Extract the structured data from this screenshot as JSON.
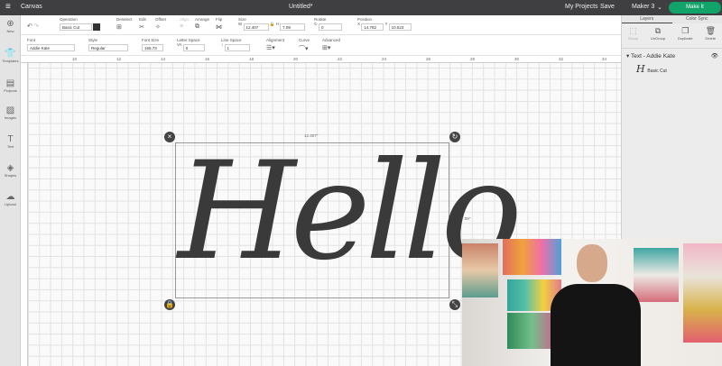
{
  "topbar": {
    "title": "Canvas",
    "doc": "Untitled*",
    "my_projects": "My Projects",
    "save": "Save",
    "machine": "Maker 3",
    "make_it": "Make It"
  },
  "sidebar": [
    "New",
    "Templates",
    "Projects",
    "Images",
    "Text",
    "Shapes",
    "Upload"
  ],
  "toolbar1": {
    "operation_label": "Operation",
    "operation": "Basic Cut",
    "deselect": "Deselect",
    "edit": "Edit",
    "offset": "Offset",
    "align": "Align",
    "arrange": "Arrange",
    "flip": "Flip",
    "size": "Size",
    "w_label": "W",
    "w": "12.407",
    "h_label": "H",
    "h": "7.09",
    "rotate": "Rotate",
    "rotate_val": "0",
    "position": "Position",
    "x_label": "X",
    "x": "14.782",
    "y_label": "Y",
    "y": "10.523"
  },
  "toolbar2": {
    "font_label": "Font",
    "font": "Addie Kate",
    "style_label": "Style",
    "style": "Regular",
    "font_size_label": "Font Size",
    "font_size": "165.73",
    "letter_space_label": "Letter Space",
    "letter_space": "0",
    "line_space_label": "Line Space",
    "line_space": "1",
    "alignment": "Alignment",
    "curve": "Curve",
    "advanced": "Advanced"
  },
  "ruler": [
    "10",
    "12",
    "14",
    "16",
    "18",
    "20",
    "22",
    "24",
    "26",
    "28",
    "30",
    "32",
    "34"
  ],
  "canvas": {
    "text": "Hello",
    "width_dim": "12.407\"",
    "height_dim": "7.09\""
  },
  "layers": {
    "tabs": [
      "Layers",
      "Color Sync"
    ],
    "tools": [
      "Group",
      "UnGroup",
      "Duplicate",
      "Delete"
    ],
    "group": "Text - Addie Kate",
    "item": "Basic Cut"
  }
}
